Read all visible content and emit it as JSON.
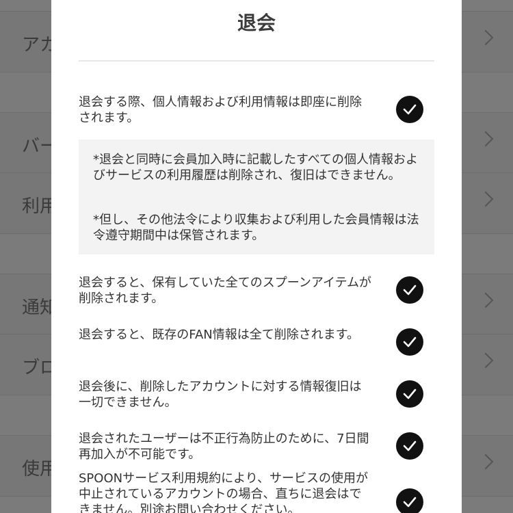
{
  "background": {
    "rows": [
      {
        "label": "アカ"
      },
      {
        "label": "バー"
      },
      {
        "label": "利用"
      },
      {
        "label": "通知"
      },
      {
        "label": "ブロ"
      },
      {
        "label": "使用"
      }
    ]
  },
  "modal": {
    "title": "退会",
    "items": [
      {
        "text": "退会する際、個人情報および利用情報は即座に削除されます。",
        "checked": true
      },
      {
        "text": "退会すると、保有していた全てのスプーンアイテムが削除されます。",
        "checked": true
      },
      {
        "text": "退会すると、既存のFAN情報は全て削除されます。",
        "checked": true
      },
      {
        "text": "退会後に、削除したアカウントに対する情報復旧は一切できません。",
        "checked": true
      },
      {
        "text": "退会されたユーザーは不正行為防止のために、7日間再加入が不可能です。",
        "checked": true
      },
      {
        "text": "SPOONサービス利用規約により、サービスの使用が中止されているアカウントの場合、直ちに退会はできません。別途お問い合わせください。",
        "checked": true
      }
    ],
    "notice": {
      "line1": "*退会と同時に会員加入時に記載したすべての個人情報およびサービスの利用履歴は削除され、復旧はできません。",
      "line2": "*但し、その他法令により収集および利用した会員情報は法令遵守期間中は保管されます。"
    }
  }
}
